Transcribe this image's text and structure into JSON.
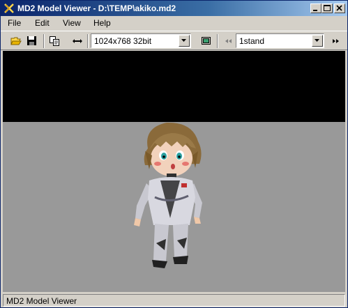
{
  "window": {
    "title": "MD2 Model Viewer - D:\\TEMP\\akiko.md2"
  },
  "menu": {
    "items": [
      "File",
      "Edit",
      "View",
      "Help"
    ]
  },
  "toolbar": {
    "resolution": "1024x768 32bit",
    "animation": "1stand"
  },
  "status": {
    "text": "MD2 Model Viewer"
  },
  "colors": {
    "titlebar_start": "#0a246a",
    "viewport_bg": "#999999",
    "viewport_top": "#000000"
  }
}
